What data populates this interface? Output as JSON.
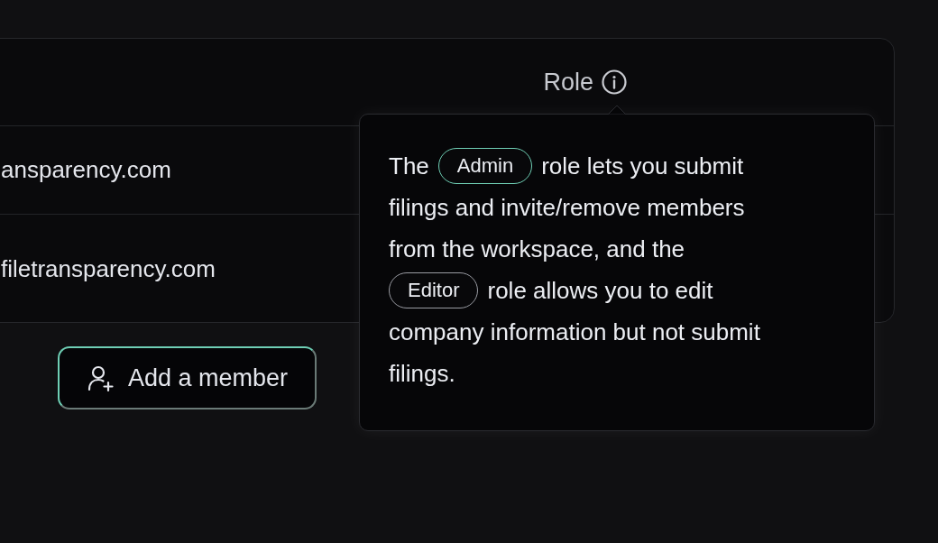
{
  "table": {
    "columns": [
      {
        "label": "Role"
      }
    ],
    "rows": [
      {
        "email": "ansparency.com"
      },
      {
        "email": "filetransparency.com"
      }
    ]
  },
  "add_button": {
    "label": "Add a member"
  },
  "tooltip": {
    "lines": [
      [
        {
          "kind": "text",
          "text": "The"
        },
        {
          "kind": "badge",
          "text": "Admin",
          "color": "#6fcfb5"
        },
        {
          "kind": "text",
          "text": "role lets you submit"
        }
      ],
      [
        {
          "kind": "text",
          "text": "filings and invite/remove members"
        }
      ],
      [
        {
          "kind": "text",
          "text": "from the workspace, and the"
        }
      ],
      [
        {
          "kind": "badge",
          "text": "Editor",
          "color": "#9a9ca3"
        },
        {
          "kind": "text",
          "text": "role allows you to edit"
        }
      ],
      [
        {
          "kind": "text",
          "text": "company information but not submit"
        }
      ],
      [
        {
          "kind": "text",
          "text": "filings."
        }
      ]
    ]
  }
}
